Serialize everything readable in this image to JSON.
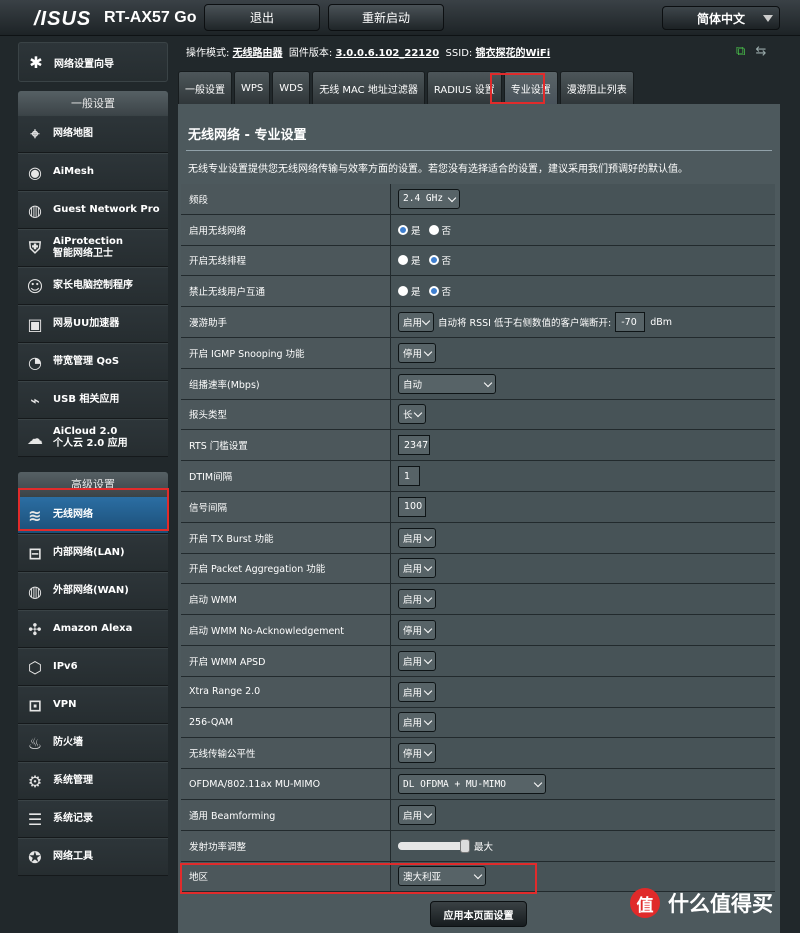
{
  "header": {
    "logo": "/ISUS",
    "model": "RT-AX57 Go",
    "logout": "退出",
    "reboot": "重新启动",
    "language": "简体中文"
  },
  "info": {
    "mode_label": "操作模式:",
    "mode_value": "无线路由器",
    "fw_label": "固件版本:",
    "fw_value": "3.0.0.6.102_22120",
    "ssid_label": "SSID:",
    "ssid_value": "锦衣探花的WiFi"
  },
  "sidebar": {
    "quick_setup": "网络设置向导",
    "general_header": "一般设置",
    "general": [
      {
        "label": "网络地图",
        "icon": "map-icon"
      },
      {
        "label": "AiMesh",
        "icon": "aimesh-icon"
      },
      {
        "label": "Guest Network Pro",
        "icon": "globe-icon"
      },
      {
        "label": "AiProtection",
        "label2": "智能网络卫士",
        "icon": "shield-icon"
      },
      {
        "label": "家长电脑控制程序",
        "icon": "family-icon"
      },
      {
        "label": "网易UU加速器",
        "icon": "uu-icon"
      },
      {
        "label": "带宽管理 QoS",
        "icon": "gauge-icon"
      },
      {
        "label": "USB 相关应用",
        "icon": "usb-icon"
      },
      {
        "label": "AiCloud 2.0",
        "label2": "个人云 2.0 应用",
        "icon": "cloud-icon"
      }
    ],
    "advanced_header": "高级设置",
    "advanced": [
      {
        "label": "无线网络",
        "icon": "wifi-icon"
      },
      {
        "label": "内部网络(LAN)",
        "icon": "lan-icon"
      },
      {
        "label": "外部网络(WAN)",
        "icon": "wan-icon"
      },
      {
        "label": "Amazon Alexa",
        "icon": "alexa-icon"
      },
      {
        "label": "IPv6",
        "icon": "ipv6-icon"
      },
      {
        "label": "VPN",
        "icon": "vpn-icon"
      },
      {
        "label": "防火墙",
        "icon": "fire-icon"
      },
      {
        "label": "系统管理",
        "icon": "gear-icon"
      },
      {
        "label": "系统记录",
        "icon": "log-icon"
      },
      {
        "label": "网络工具",
        "icon": "tools-icon"
      }
    ]
  },
  "tabs": [
    "一般设置",
    "WPS",
    "WDS",
    "无线 MAC 地址过滤器",
    "RADIUS 设置",
    "专业设置",
    "漫游阻止列表"
  ],
  "main": {
    "title": "无线网络 - 专业设置",
    "description": "无线专业设置提供您无线网络传输与效率方面的设置。若您没有选择适合的设置，建议采用我们预调好的默认值。",
    "radio_yes": "是",
    "radio_no": "否",
    "rows": [
      {
        "label": "频段",
        "value": "2.4 GHz"
      },
      {
        "label": "启用无线网络",
        "value": "是"
      },
      {
        "label": "开启无线排程",
        "value": "否"
      },
      {
        "label": "禁止无线用户互通",
        "value": "否"
      },
      {
        "label": "漫游助手",
        "value": "启用",
        "extra": "自动将 RSSI 低于右侧数值的客户端断开:",
        "rssi": "-70",
        "unit": "dBm"
      },
      {
        "label": "开启 IGMP Snooping 功能",
        "value": "停用"
      },
      {
        "label": "组播速率(Mbps)",
        "value": "自动"
      },
      {
        "label": "报头类型",
        "value": "长"
      },
      {
        "label": "RTS 门槛设置",
        "value": "2347"
      },
      {
        "label": "DTIM间隔",
        "value": "1"
      },
      {
        "label": "信号间隔",
        "value": "100"
      },
      {
        "label": "开启 TX Burst 功能",
        "value": "启用"
      },
      {
        "label": "开启 Packet Aggregation 功能",
        "value": "启用"
      },
      {
        "label": "启动 WMM",
        "value": "启用"
      },
      {
        "label": "启动 WMM No-Acknowledgement",
        "value": "停用"
      },
      {
        "label": "开启 WMM APSD",
        "value": "启用"
      },
      {
        "label": "Xtra Range 2.0",
        "value": "启用"
      },
      {
        "label": "256-QAM",
        "value": "启用"
      },
      {
        "label": "无线传输公平性",
        "value": "停用"
      },
      {
        "label": "OFDMA/802.11ax MU-MIMO",
        "value": "DL OFDMA + MU-MIMO"
      },
      {
        "label": "通用 Beamforming",
        "value": "启用"
      },
      {
        "label": "发射功率调整",
        "value": "最大",
        "level_percent": 100
      },
      {
        "label": "地区",
        "value": "澳大利亚"
      }
    ],
    "apply": "应用本页面设置"
  },
  "watermark": {
    "badge": "值",
    "text": "什么值得买"
  },
  "colors": {
    "highlight": "#e12b2b",
    "active_menu": "#2b6ea3",
    "panel": "#4d595d"
  }
}
